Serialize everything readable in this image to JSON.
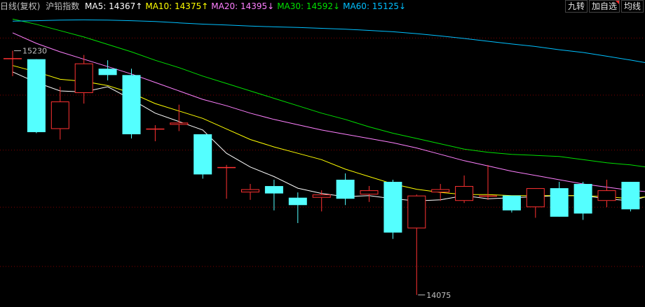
{
  "header": {
    "title": "日线(复权)",
    "name": "沪铅指数",
    "ma": [
      {
        "label": "MA5:",
        "value": "14367",
        "arrow": "↑",
        "color": "#ffffff"
      },
      {
        "label": "MA10:",
        "value": "14375",
        "arrow": "↑",
        "color": "#ffff00"
      },
      {
        "label": "MA20:",
        "value": "14395",
        "arrow": "↓",
        "color": "#ff80ff"
      },
      {
        "label": "MA30:",
        "value": "14592",
        "arrow": "↓",
        "color": "#00e000"
      },
      {
        "label": "MA60:",
        "value": "15125",
        "arrow": "↓",
        "color": "#00c0ff"
      }
    ]
  },
  "buttons": {
    "jiuzhuan": "九转",
    "add_watch": "加自选",
    "junxian": "均线"
  },
  "colors": {
    "up": "#ff3232",
    "down": "#54ffff",
    "bg": "#000000",
    "grid": "#800000",
    "text": "#c0c0c0"
  },
  "chart_data": {
    "type": "candlestick",
    "ylim": [
      14018,
      15470
    ],
    "gridlines": [
      15290,
      15020,
      14760,
      14490,
      14210
    ],
    "candles": [
      {
        "open": 15195,
        "high": 15230,
        "low": 15110,
        "close": 15195
      },
      {
        "open": 15190,
        "high": 15190,
        "low": 14840,
        "close": 14845
      },
      {
        "open": 14860,
        "high": 15060,
        "low": 14810,
        "close": 14990
      },
      {
        "open": 15030,
        "high": 15210,
        "low": 14980,
        "close": 15170
      },
      {
        "open": 15145,
        "high": 15185,
        "low": 15090,
        "close": 15115
      },
      {
        "open": 15115,
        "high": 15145,
        "low": 14815,
        "close": 14835
      },
      {
        "open": 14862,
        "high": 14878,
        "low": 14802,
        "close": 14862
      },
      {
        "open": 14880,
        "high": 14975,
        "low": 14850,
        "close": 14890
      },
      {
        "open": 14835,
        "high": 14835,
        "low": 14625,
        "close": 14645
      },
      {
        "open": 14680,
        "high": 14690,
        "low": 14530,
        "close": 14680
      },
      {
        "open": 14560,
        "high": 14600,
        "low": 14525,
        "close": 14575
      },
      {
        "open": 14590,
        "high": 14620,
        "low": 14475,
        "close": 14555
      },
      {
        "open": 14535,
        "high": 14560,
        "low": 14415,
        "close": 14500
      },
      {
        "open": 14535,
        "high": 14570,
        "low": 14470,
        "close": 14550
      },
      {
        "open": 14620,
        "high": 14650,
        "low": 14500,
        "close": 14530
      },
      {
        "open": 14550,
        "high": 14590,
        "low": 14515,
        "close": 14570
      },
      {
        "open": 14610,
        "high": 14620,
        "low": 14340,
        "close": 14370
      },
      {
        "open": 14390,
        "high": 14550,
        "low": 14075,
        "close": 14545
      },
      {
        "open": 14560,
        "high": 14600,
        "low": 14520,
        "close": 14575
      },
      {
        "open": 14520,
        "high": 14640,
        "low": 14510,
        "close": 14590
      },
      {
        "open": 14545,
        "high": 14690,
        "low": 14525,
        "close": 14545
      },
      {
        "open": 14545,
        "high": 14545,
        "low": 14465,
        "close": 14475
      },
      {
        "open": 14490,
        "high": 14580,
        "low": 14440,
        "close": 14580
      },
      {
        "open": 14580,
        "high": 14610,
        "low": 14445,
        "close": 14445
      },
      {
        "open": 14600,
        "high": 14610,
        "low": 14430,
        "close": 14460
      },
      {
        "open": 14520,
        "high": 14620,
        "low": 14490,
        "close": 14570
      },
      {
        "open": 14610,
        "high": 14610,
        "low": 14470,
        "close": 14480
      },
      {
        "open": 14550,
        "high": 14660,
        "low": 14540,
        "close": 14650
      }
    ],
    "ma_lines": [
      {
        "name": "MA5",
        "color": "#ffffff",
        "values": [
          15130,
          15080,
          15040,
          15035,
          15060,
          15000,
          14935,
          14895,
          14855,
          14745,
          14680,
          14635,
          14580,
          14555,
          14540,
          14545,
          14530,
          14520,
          14525,
          14545,
          14530,
          14535,
          14540,
          14545,
          14545,
          14530,
          14520,
          14550
        ]
      },
      {
        "open_note": "",
        "name": "MA10",
        "color": "#ffff00",
        "values": [
          15160,
          15130,
          15095,
          15085,
          15065,
          15030,
          14980,
          14945,
          14910,
          14860,
          14810,
          14775,
          14745,
          14715,
          14670,
          14635,
          14600,
          14575,
          14560,
          14550,
          14550,
          14545,
          14545,
          14545,
          14545,
          14540,
          14530,
          14545
        ]
      },
      {
        "name": "MA20",
        "color": "#ff80ff",
        "values": [
          15315,
          15265,
          15225,
          15190,
          15155,
          15120,
          15080,
          15040,
          15000,
          14970,
          14935,
          14905,
          14880,
          14855,
          14835,
          14815,
          14795,
          14770,
          14740,
          14710,
          14685,
          14660,
          14640,
          14620,
          14600,
          14585,
          14570,
          14560
        ]
      },
      {
        "name": "MA30",
        "color": "#00e000",
        "values": [
          15380,
          15355,
          15325,
          15295,
          15260,
          15225,
          15185,
          15150,
          15110,
          15075,
          15040,
          15005,
          14970,
          14935,
          14905,
          14870,
          14840,
          14815,
          14790,
          14765,
          14750,
          14740,
          14735,
          14730,
          14715,
          14700,
          14690,
          14675
        ]
      },
      {
        "name": "MA60",
        "color": "#00c0ff",
        "values": [
          15370,
          15372,
          15375,
          15376,
          15375,
          15372,
          15368,
          15362,
          15356,
          15352,
          15347,
          15343,
          15340,
          15336,
          15332,
          15326,
          15320,
          15311,
          15300,
          15288,
          15275,
          15262,
          15250,
          15235,
          15222,
          15204,
          15186,
          15166
        ]
      }
    ],
    "annotations": [
      {
        "text": "15230",
        "candle": 0,
        "value": 15230
      },
      {
        "text": "14075",
        "candle": 17,
        "value": 14075
      }
    ]
  }
}
